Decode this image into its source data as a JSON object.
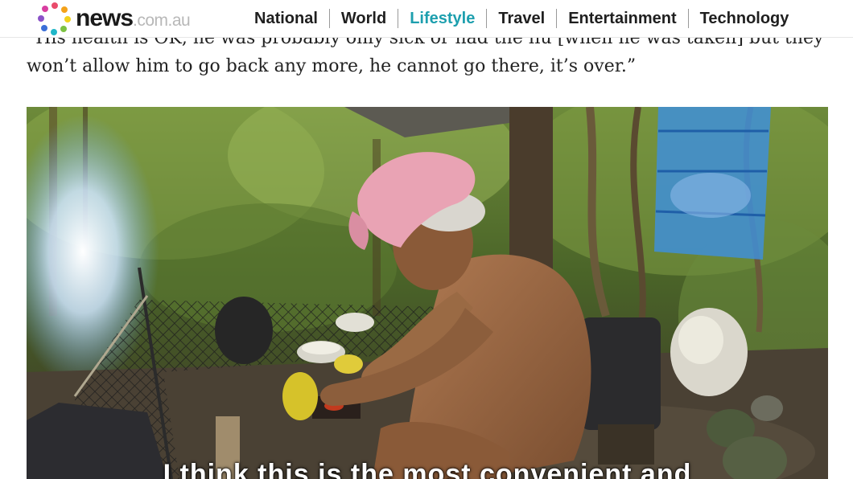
{
  "site": {
    "logo_word": "news",
    "logo_tld": ".com.au"
  },
  "nav": {
    "items": [
      {
        "label": "National",
        "active": false
      },
      {
        "label": "World",
        "active": false
      },
      {
        "label": "Lifestyle",
        "active": true
      },
      {
        "label": "Travel",
        "active": false
      },
      {
        "label": "Entertainment",
        "active": false
      },
      {
        "label": "Technology",
        "active": false
      }
    ],
    "active_color": "#1d9fae"
  },
  "article": {
    "paragraph": "“His health is OK, he was probably only sick or had the flu [when he was taken] but they won’t allow him to go back any more, he cannot go there, it’s over.”"
  },
  "photo": {
    "subtitle": "I think this is the most convenient and"
  },
  "icons": [
    "logo-dots-icon"
  ]
}
